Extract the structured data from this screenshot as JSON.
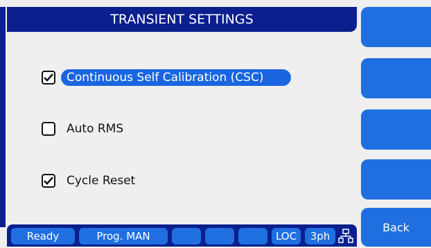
{
  "header": {
    "title": "TRANSIENT SETTINGS"
  },
  "settings": [
    {
      "label": "Continuous Self Calibration (CSC)",
      "checked": true,
      "selected": true
    },
    {
      "label": "Auto RMS",
      "checked": false,
      "selected": false
    },
    {
      "label": "Cycle Reset",
      "checked": true,
      "selected": false
    }
  ],
  "softkeys": [
    "",
    "",
    "",
    "",
    "Back"
  ],
  "statusbar": {
    "ready": "Ready",
    "prog": "Prog. MAN",
    "blank1": "",
    "blank2": "",
    "blank3": "",
    "loc": "LOC",
    "phase": "3ph",
    "network_icon": "network-icon"
  },
  "colors": {
    "header_bg": "#0b1f8e",
    "accent": "#1f6fe0",
    "selected": "#1a66e0",
    "background": "#efefef"
  }
}
